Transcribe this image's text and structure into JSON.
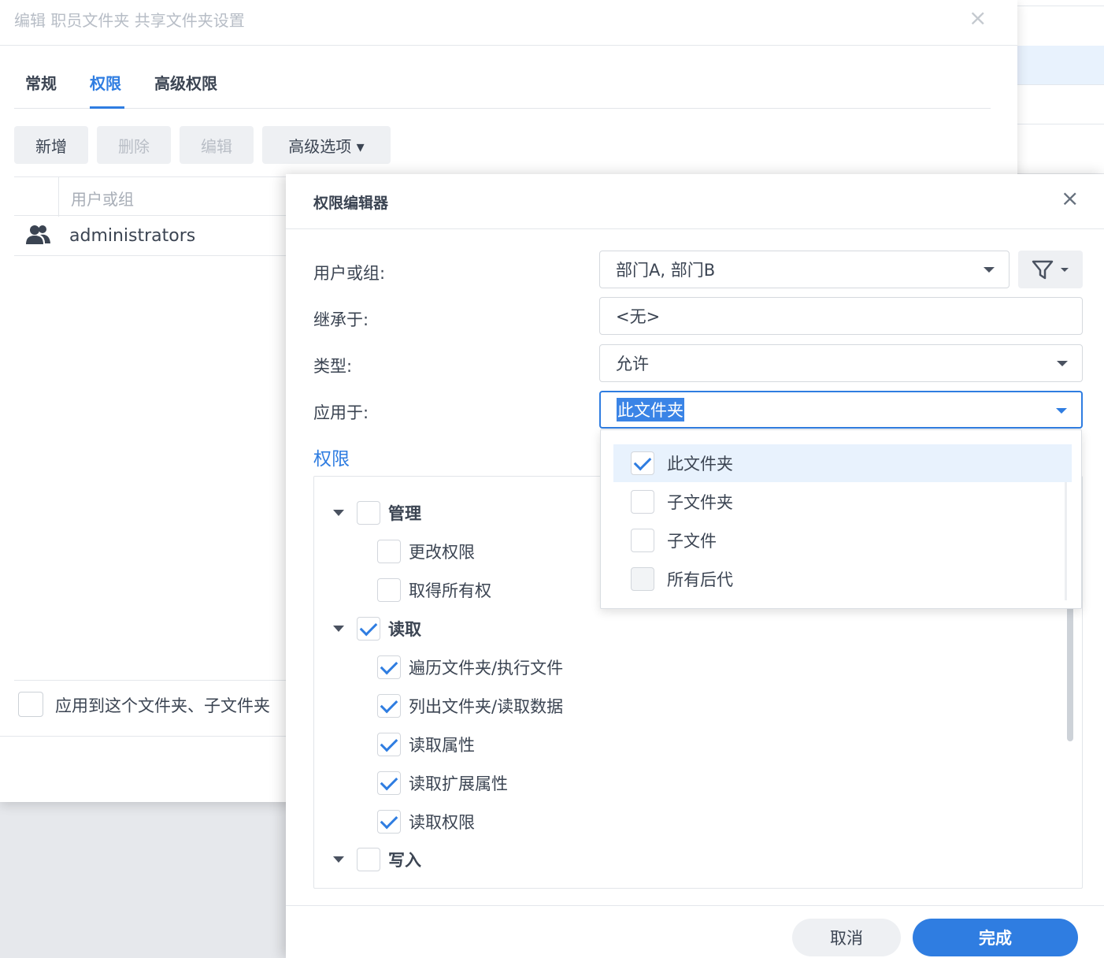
{
  "background_dialog": {
    "title": "编辑 职员文件夹 共享文件夹设置",
    "close_glyph": "×",
    "tabs": [
      "常规",
      "权限",
      "高级权限"
    ],
    "active_tab": "权限",
    "toolbar": {
      "add": "新增",
      "delete": "删除",
      "edit": "编辑",
      "advanced": "高级选项 ▾"
    },
    "grid_header": "用户或组",
    "grid_rows": [
      {
        "icon": "users-icon",
        "name": "administrators"
      }
    ],
    "apply_to_label": "应用到这个文件夹、子文件夹"
  },
  "modal": {
    "title": "权限编辑器",
    "close_glyph": "×",
    "fields": {
      "user_or_group": {
        "label": "用户或组:",
        "value": "部门A, 部门B"
      },
      "inherit_from": {
        "label": "继承于:",
        "value": "<无>"
      },
      "type": {
        "label": "类型:",
        "value": "允许"
      },
      "apply_to": {
        "label": "应用于:",
        "value": "此文件夹"
      }
    },
    "permissions_header": "权限",
    "tree": [
      {
        "label": "管理",
        "checked": false,
        "expanded": true,
        "children": [
          {
            "label": "更改权限",
            "checked": false
          },
          {
            "label": "取得所有权",
            "checked": false
          }
        ]
      },
      {
        "label": "读取",
        "checked": true,
        "expanded": true,
        "children": [
          {
            "label": "遍历文件夹/执行文件",
            "checked": true
          },
          {
            "label": "列出文件夹/读取数据",
            "checked": true
          },
          {
            "label": "读取属性",
            "checked": true
          },
          {
            "label": "读取扩展属性",
            "checked": true
          },
          {
            "label": "读取权限",
            "checked": true
          }
        ]
      },
      {
        "label": "写入",
        "checked": false,
        "expanded": true
      }
    ],
    "buttons": {
      "cancel": "取消",
      "done": "完成"
    },
    "accent_color": "#2f7de1"
  },
  "apply_to_dropdown": {
    "options": [
      {
        "label": "此文件夹",
        "checked": true
      },
      {
        "label": "子文件夹",
        "checked": false
      },
      {
        "label": "子文件",
        "checked": false
      },
      {
        "label": "所有后代",
        "checked": false
      }
    ]
  }
}
